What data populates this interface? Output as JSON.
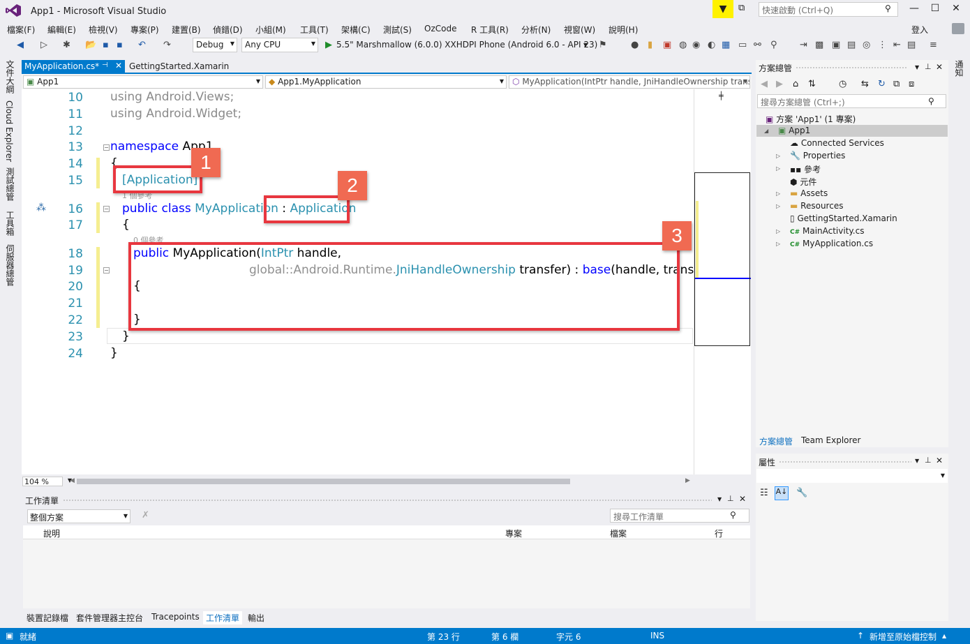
{
  "window": {
    "title": "App1 - Microsoft Visual Studio",
    "quick_launch": "快速啟動 (Ctrl+Q)"
  },
  "menu": [
    "檔案(F)",
    "編輯(E)",
    "檢視(V)",
    "專案(P)",
    "建置(B)",
    "偵錯(D)",
    "小組(M)",
    "工具(T)",
    "架構(C)",
    "測試(S)",
    "OzCode",
    "R 工具(R)",
    "分析(N)",
    "視窗(W)",
    "說明(H)"
  ],
  "login": "登入",
  "toolbar": {
    "config": "Debug",
    "platform": "Any CPU",
    "run_target": "5.5\" Marshmallow (6.0.0) XXHDPI Phone (Android 6.0 - API 23)"
  },
  "left_rail": [
    "文件大綱",
    "Cloud Explorer",
    "測試總管",
    "工具箱",
    "伺服器總管"
  ],
  "right_rail": [
    "通知"
  ],
  "tabs": {
    "active": "MyApplication.cs*",
    "other": "GettingStarted.Xamarin"
  },
  "nav": {
    "project": "App1",
    "type": "App1.MyApplication",
    "member": "MyApplication(IntPtr handle, JniHandleOwnership trans"
  },
  "lines": [
    {
      "n": "10",
      "text": "using Android.Views;"
    },
    {
      "n": "11",
      "text": "using Android.Widget;"
    },
    {
      "n": "12",
      "text": ""
    },
    {
      "n": "13",
      "text": "namespace App1"
    },
    {
      "n": "14",
      "text": "{"
    },
    {
      "n": "15",
      "text": "[Application]"
    },
    {
      "n": "16",
      "text": "public class MyApplication : Application"
    },
    {
      "n": "17",
      "text": "{"
    },
    {
      "n": "18",
      "text": "public MyApplication(IntPtr handle,"
    },
    {
      "n": "19",
      "text": "global::Android.Runtime.JniHandleOwnership transfer) : base(handle, transfer)"
    },
    {
      "n": "20",
      "text": "{"
    },
    {
      "n": "21",
      "text": ""
    },
    {
      "n": "22",
      "text": "}"
    },
    {
      "n": "23",
      "text": "}"
    },
    {
      "n": "24",
      "text": "}"
    }
  ],
  "code": {
    "l10_kw": "using",
    "l10_rest": " Android.Views;",
    "l11_kw": "using",
    "l11_rest": " Android.Widget;",
    "l13_kw": "namespace",
    "l13_rest": " App1",
    "brace_open": "{",
    "brace_close": "}",
    "l15": "[Application]",
    "l16_kw": "public class ",
    "l16_name": "MyApplication",
    "l16_sep": " : ",
    "l16_base": "Application",
    "l18_kw": "public",
    "l18_name": " MyApplication(",
    "l18_type": "IntPtr",
    "l18_rest": " handle,",
    "l19_global": "global",
    "l19_ns": "::Android.Runtime.",
    "l19_type": "JniHandleOwnership",
    "l19_mid": " transfer) : ",
    "l19_base": "base",
    "l19_rest": "(handle, transfer)",
    "lens1": "1 個參考",
    "lens2": "0 個參考"
  },
  "callouts": [
    "1",
    "2",
    "3"
  ],
  "zoom": "104 %",
  "tasklist": {
    "title": "工作清單",
    "filter": "整個方案",
    "search": "搜尋工作清單",
    "columns": [
      "說明",
      "專案",
      "檔案",
      "行"
    ]
  },
  "bottom_tabs": [
    "裝置記錄檔",
    "套件管理器主控台",
    "Tracepoints",
    "工作清單",
    "輸出"
  ],
  "solution_explorer": {
    "title": "方案總管",
    "search": "搜尋方案總管 (Ctrl+;)",
    "solution": "方案 'App1' (1 專案)",
    "project": "App1",
    "items": [
      "Connected Services",
      "Properties",
      "參考",
      "元件",
      "Assets",
      "Resources",
      "GettingStarted.Xamarin",
      "MainActivity.cs",
      "MyApplication.cs"
    ]
  },
  "se_tabs": [
    "方案總管",
    "Team Explorer"
  ],
  "properties": {
    "title": "屬性"
  },
  "status": {
    "left": "就緒",
    "line": "第 23 行",
    "col": "第 6 欄",
    "ch": "字元 6",
    "ins": "INS",
    "right": "新增至原始檔控制"
  }
}
